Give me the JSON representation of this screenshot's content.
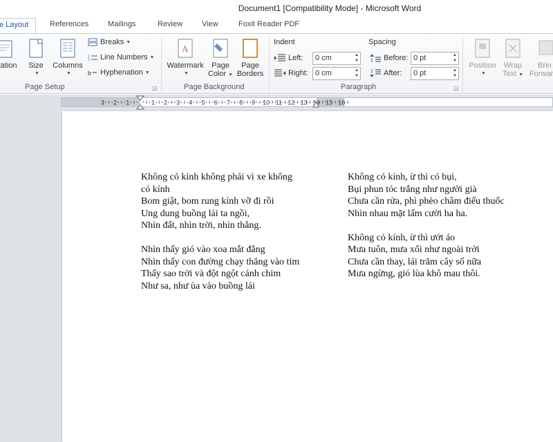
{
  "window": {
    "title": "Document1 [Compatibility Mode]  -  Microsoft Word"
  },
  "tabs": [
    "e Layout",
    "References",
    "Mailings",
    "Review",
    "View",
    "Foxit Reader PDF"
  ],
  "ribbon": {
    "page_setup": {
      "label": "Page Setup",
      "orientation": "ntation",
      "size": "Size",
      "columns": "Columns",
      "breaks": "Breaks",
      "line_numbers": "Line Numbers",
      "hyphenation": "Hyphenation"
    },
    "page_background": {
      "label": "Page Background",
      "watermark": "Watermark",
      "page_color_1": "Page",
      "page_color_2": "Color",
      "page_borders_1": "Page",
      "page_borders_2": "Borders"
    },
    "paragraph": {
      "label": "Paragraph",
      "indent_title": "Indent",
      "spacing_title": "Spacing",
      "left_label": "Left:",
      "left_value": "0 cm",
      "right_label": "Right:",
      "right_value": "0 cm",
      "before_label": "Before:",
      "before_value": "0 pt",
      "after_label": "After:",
      "after_value": "0 pt"
    },
    "arrange": {
      "position": "Position",
      "wrap_1": "Wrap",
      "wrap_2": "Text",
      "bring_1": "Brin",
      "bring_2": "Forwar"
    }
  },
  "ruler": {
    "labels": [
      "3",
      "2",
      "1",
      "1",
      "2",
      "3",
      "4",
      "5",
      "6",
      "7",
      "8",
      "9",
      "10",
      "11",
      "12",
      "13",
      "14",
      "15",
      "16"
    ]
  },
  "document": {
    "column_left": [
      [
        "Không có kính không phải vì xe không",
        "có kính",
        "Bom giật, bom rung kính vỡ đi rồi",
        "Ung dung buồng lái ta ngồi,",
        "Nhìn đất, nhìn trời, nhìn thẳng."
      ],
      [
        "Nhìn thấy gió vào xoa mắt đắng",
        "Nhìn thấy con đường chạy thẳng vào tim",
        "Thấy sao trời và đột ngột cánh chim",
        "Như sa, như ùa vào buồng lái"
      ]
    ],
    "column_right": [
      [
        "Không có kính, ừ thì có bụi,",
        "Bụi phun tóc trắng như người già",
        "Chưa cần rửa, phì phèo châm điếu thuốc",
        "Nhìn nhau mặt lấm cười ha ha."
      ],
      [
        "Không có kính, ừ thì ướt áo",
        "Mưa tuôn, mưa xối như ngoài trời",
        "Chưa cần thay, lái trăm cây số nữa",
        "Mưa ngừng, gió lùa khô mau thôi."
      ]
    ]
  }
}
